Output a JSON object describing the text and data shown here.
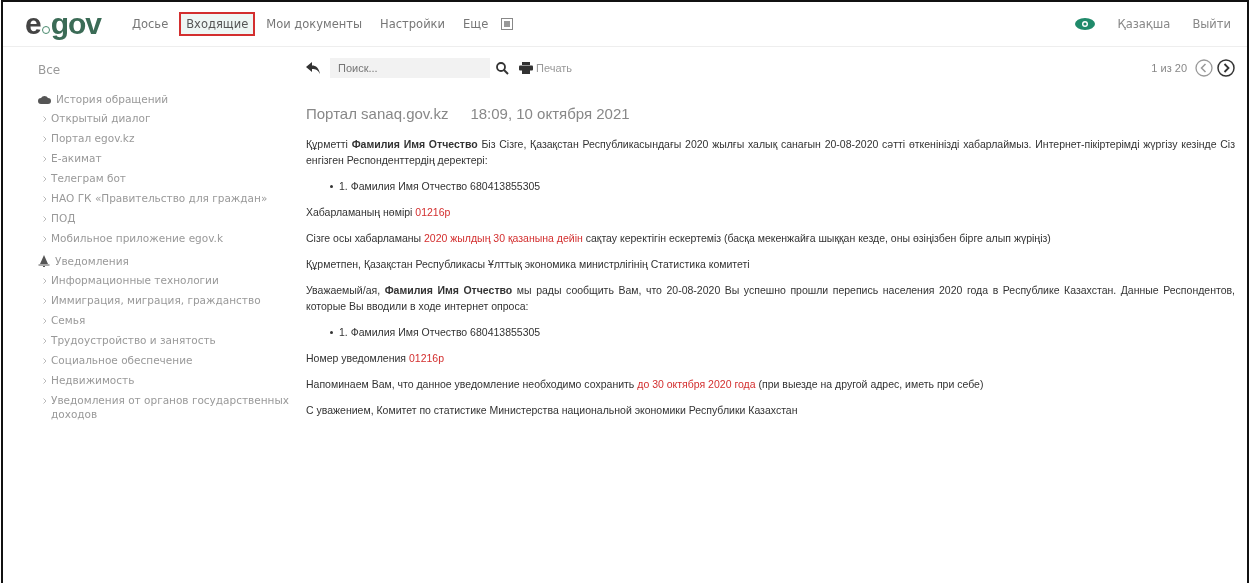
{
  "logo": {
    "prefix": "e",
    "suffix": "gov"
  },
  "nav": [
    {
      "label": "Досье",
      "selected": false
    },
    {
      "label": "Входящие",
      "selected": true
    },
    {
      "label": "Мои документы",
      "selected": false
    },
    {
      "label": "Настройки",
      "selected": false
    },
    {
      "label": "Еще",
      "selected": false
    }
  ],
  "header_right": {
    "language": "Қазақша",
    "logout": "Выйти"
  },
  "sidebar": {
    "all": "Все",
    "groups": [
      {
        "label": "История обращений",
        "kind": "cloud",
        "children": [
          {
            "label": "Открытый диалог"
          },
          {
            "label": "Портал egov.kz"
          },
          {
            "label": "E-акимат"
          },
          {
            "label": "Телеграм бот"
          },
          {
            "label": "НАО ГК «Правительство для граждан»"
          },
          {
            "label": "ПОД"
          },
          {
            "label": "Мобильное приложение egov.k"
          }
        ]
      },
      {
        "label": "Уведомления",
        "kind": "bell",
        "children": [
          {
            "label": "Информационные технологии"
          },
          {
            "label": "Иммиграция, миграция, гражданство"
          },
          {
            "label": "Семья"
          },
          {
            "label": "Трудоустройство и занятость"
          },
          {
            "label": "Социальное обеспечение"
          },
          {
            "label": "Недвижимость"
          },
          {
            "label": "Уведомления от органов государственных доходов"
          }
        ]
      }
    ]
  },
  "toolbar": {
    "search": {
      "placeholder": "Поиск..."
    },
    "print": "Печать",
    "pager": "1 из 20"
  },
  "message": {
    "sender": "Портал sanaq.gov.kz",
    "date": "18:09, 10 октября 2021",
    "blocks": [
      {
        "kind": "para",
        "segments": [
          {
            "text": "Құрметті ",
            "kind": "plain"
          },
          {
            "text": "Фамилия Имя Отчество",
            "kind": "bold"
          },
          {
            "text": " Біз Сізге, Қазақстан Республикасындағы 2020 жылғы халық санағын 20-08-2020 сәтті өткенінізді хабарлаймыз. Интернет-пікіртерімді жүргізу кезінде Сіз енгізген Респонденттердің деректері:",
            "kind": "plain"
          }
        ]
      },
      {
        "kind": "bullet",
        "segments": [
          {
            "text": "1. Фамилия Имя Отчество 680413855305",
            "kind": "plain"
          }
        ]
      },
      {
        "kind": "para",
        "segments": [
          {
            "text": "Хабарламаның нөмірі ",
            "kind": "plain"
          },
          {
            "text": "01216p",
            "kind": "red"
          }
        ]
      },
      {
        "kind": "para",
        "segments": [
          {
            "text": "Сізге осы хабарламаны ",
            "kind": "plain"
          },
          {
            "text": "2020 жылдың 30 қазанына дейін",
            "kind": "red"
          },
          {
            "text": " сақтау керектігін ескертеміз (басқа мекенжайға шыққан кезде, оны өзіңізбен бірге алып жүріңіз)",
            "kind": "plain"
          }
        ]
      },
      {
        "kind": "para",
        "segments": [
          {
            "text": "Құрметпен, Қазақстан Республикасы Ұлттық экономика министрлігінің Статистика комитеті",
            "kind": "plain"
          }
        ]
      },
      {
        "kind": "para",
        "segments": [
          {
            "text": "Уважаемый/ая, ",
            "kind": "plain"
          },
          {
            "text": "Фамилия Имя Отчество",
            "kind": "bold"
          },
          {
            "text": " мы рады сообщить Вам, что 20-08-2020 Вы успешно прошли перепись населения 2020 года в Республике Казахстан. Данные Респондентов, которые Вы вводили в ходе интернет опроса:",
            "kind": "plain"
          }
        ]
      },
      {
        "kind": "bullet",
        "segments": [
          {
            "text": "1. Фамилия Имя Отчество 680413855305",
            "kind": "plain"
          }
        ]
      },
      {
        "kind": "para",
        "segments": [
          {
            "text": "Номер уведомления ",
            "kind": "plain"
          },
          {
            "text": "01216p",
            "kind": "red"
          }
        ]
      },
      {
        "kind": "para",
        "segments": [
          {
            "text": "Напоминаем Вам, что данное уведомление необходимо сохранить ",
            "kind": "plain"
          },
          {
            "text": "до 30 октября 2020 года",
            "kind": "red"
          },
          {
            "text": " (при выезде на другой адрес, иметь при себе)",
            "kind": "plain"
          }
        ]
      },
      {
        "kind": "para",
        "segments": [
          {
            "text": "С уважением, Комитет по статистике Министерства национальной экономики Республики Казахстан",
            "kind": "plain"
          }
        ]
      }
    ]
  }
}
